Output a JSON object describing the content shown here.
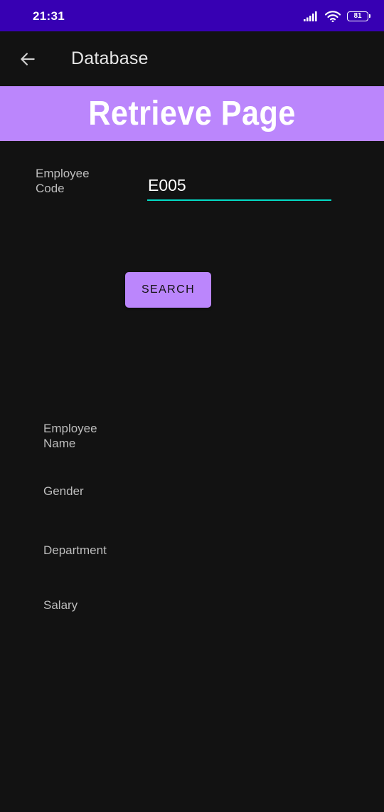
{
  "status_bar": {
    "time": "21:31",
    "battery": "81",
    "signal_icon": "signal-icon",
    "wifi_icon": "wifi-icon",
    "battery_icon": "battery-icon"
  },
  "app_bar": {
    "title": "Database",
    "back_icon": "arrow-left-icon"
  },
  "banner": {
    "title": "Retrieve Page"
  },
  "form": {
    "code_label": "Employee Code",
    "code_value": "E005",
    "search_label": "SEARCH"
  },
  "results": {
    "name_label": "Employee Name",
    "gender_label": "Gender",
    "department_label": "Department",
    "salary_label": "Salary"
  },
  "colors": {
    "status_bar": "#3700b3",
    "background": "#121212",
    "primary": "#bb86fc",
    "accent": "#03dac5"
  }
}
